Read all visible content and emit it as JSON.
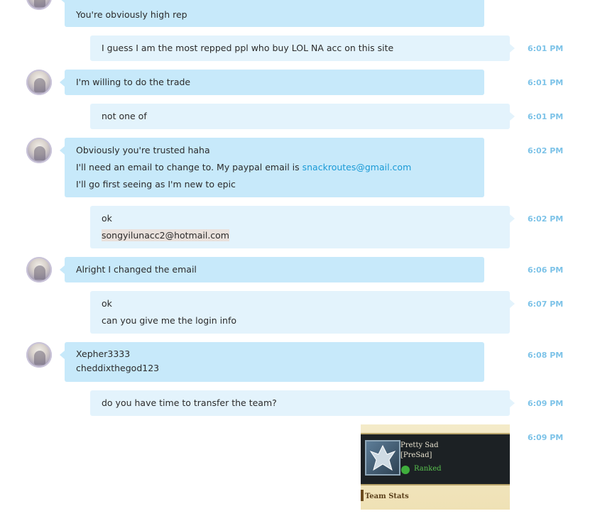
{
  "messages": [
    {
      "lines": [
        "You're obviously high rep"
      ],
      "time": ""
    },
    {
      "lines": [
        "I guess I am the most repped ppl who buy LOL NA acc on this site"
      ],
      "time": "6:01 PM"
    },
    {
      "lines": [
        "I'm willing to do the trade"
      ],
      "time": "6:01 PM"
    },
    {
      "lines": [
        "not one of"
      ],
      "time": "6:01 PM"
    },
    {
      "lines": [
        "Obviously you're trusted haha",
        "I'll need an email to change to. My paypal email is ",
        "I'll go first seeing as I'm new to epic"
      ],
      "link": "snackroutes@gmail.com",
      "time": "6:02 PM"
    },
    {
      "lines": [
        "ok",
        "songyilunacc2@hotmail.com"
      ],
      "time": "6:02 PM"
    },
    {
      "lines": [
        "Alright I changed the email"
      ],
      "time": "6:06 PM"
    },
    {
      "lines": [
        "ok",
        "can you give me the login info"
      ],
      "time": "6:07 PM"
    },
    {
      "lines": [
        "Xepher3333",
        "cheddixthegod123"
      ],
      "time": "6:08 PM"
    },
    {
      "lines": [
        "do you have time to transfer the team?"
      ],
      "time": "6:09 PM"
    },
    {
      "time": "6:09 PM"
    }
  ],
  "image": {
    "team_name": "Pretty Sad",
    "team_tag": "[PreSad]",
    "badge": "Ranked",
    "section": "Team Stats"
  },
  "colors": {
    "incoming": "#c7e9fa",
    "outgoing": "#e3f3fc",
    "timestamp": "#7dc3e8",
    "link": "#1a9ad6"
  }
}
